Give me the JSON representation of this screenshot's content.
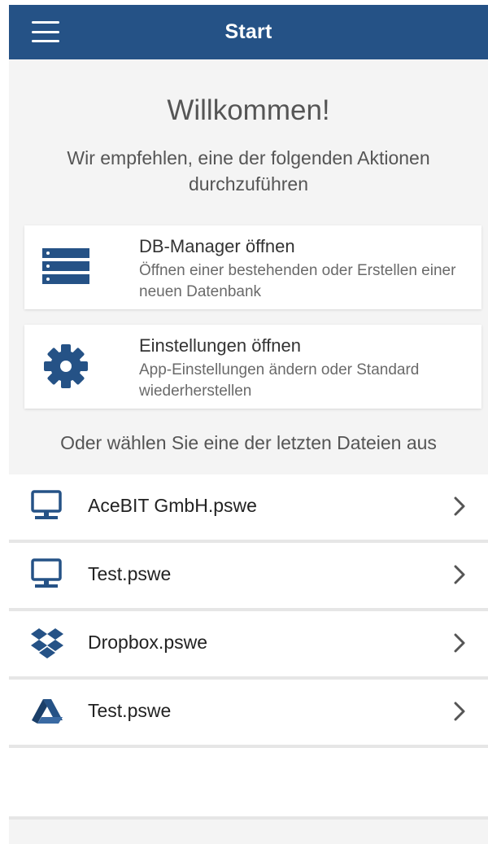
{
  "header": {
    "title": "Start",
    "menu_icon": "hamburger-menu-icon",
    "background": "#255286"
  },
  "welcome": {
    "heading": "Willkommen!",
    "subtitle": "Wir empfehlen, eine der folgenden Aktionen durchzuführen"
  },
  "actions": [
    {
      "title": "DB-Manager öffnen",
      "description": "Öffnen einer bestehenden oder Erstellen einer neuen Datenbank",
      "icon": "database-list-icon"
    },
    {
      "title": "Einstellungen öffnen",
      "description": "App-Einstellungen ändern oder Standard wiederherstellen",
      "icon": "gear-icon"
    }
  ],
  "recent": {
    "heading": "Oder wählen Sie eine der letzten Dateien aus",
    "files": [
      {
        "name": "AceBIT GmbH.pswe",
        "icon": "computer-icon"
      },
      {
        "name": "Test.pswe",
        "icon": "computer-icon"
      },
      {
        "name": "Dropbox.pswe",
        "icon": "dropbox-icon"
      },
      {
        "name": "Test.pswe",
        "icon": "google-drive-icon"
      }
    ]
  },
  "colors": {
    "accent": "#255286",
    "background": "#f4f4f4"
  }
}
